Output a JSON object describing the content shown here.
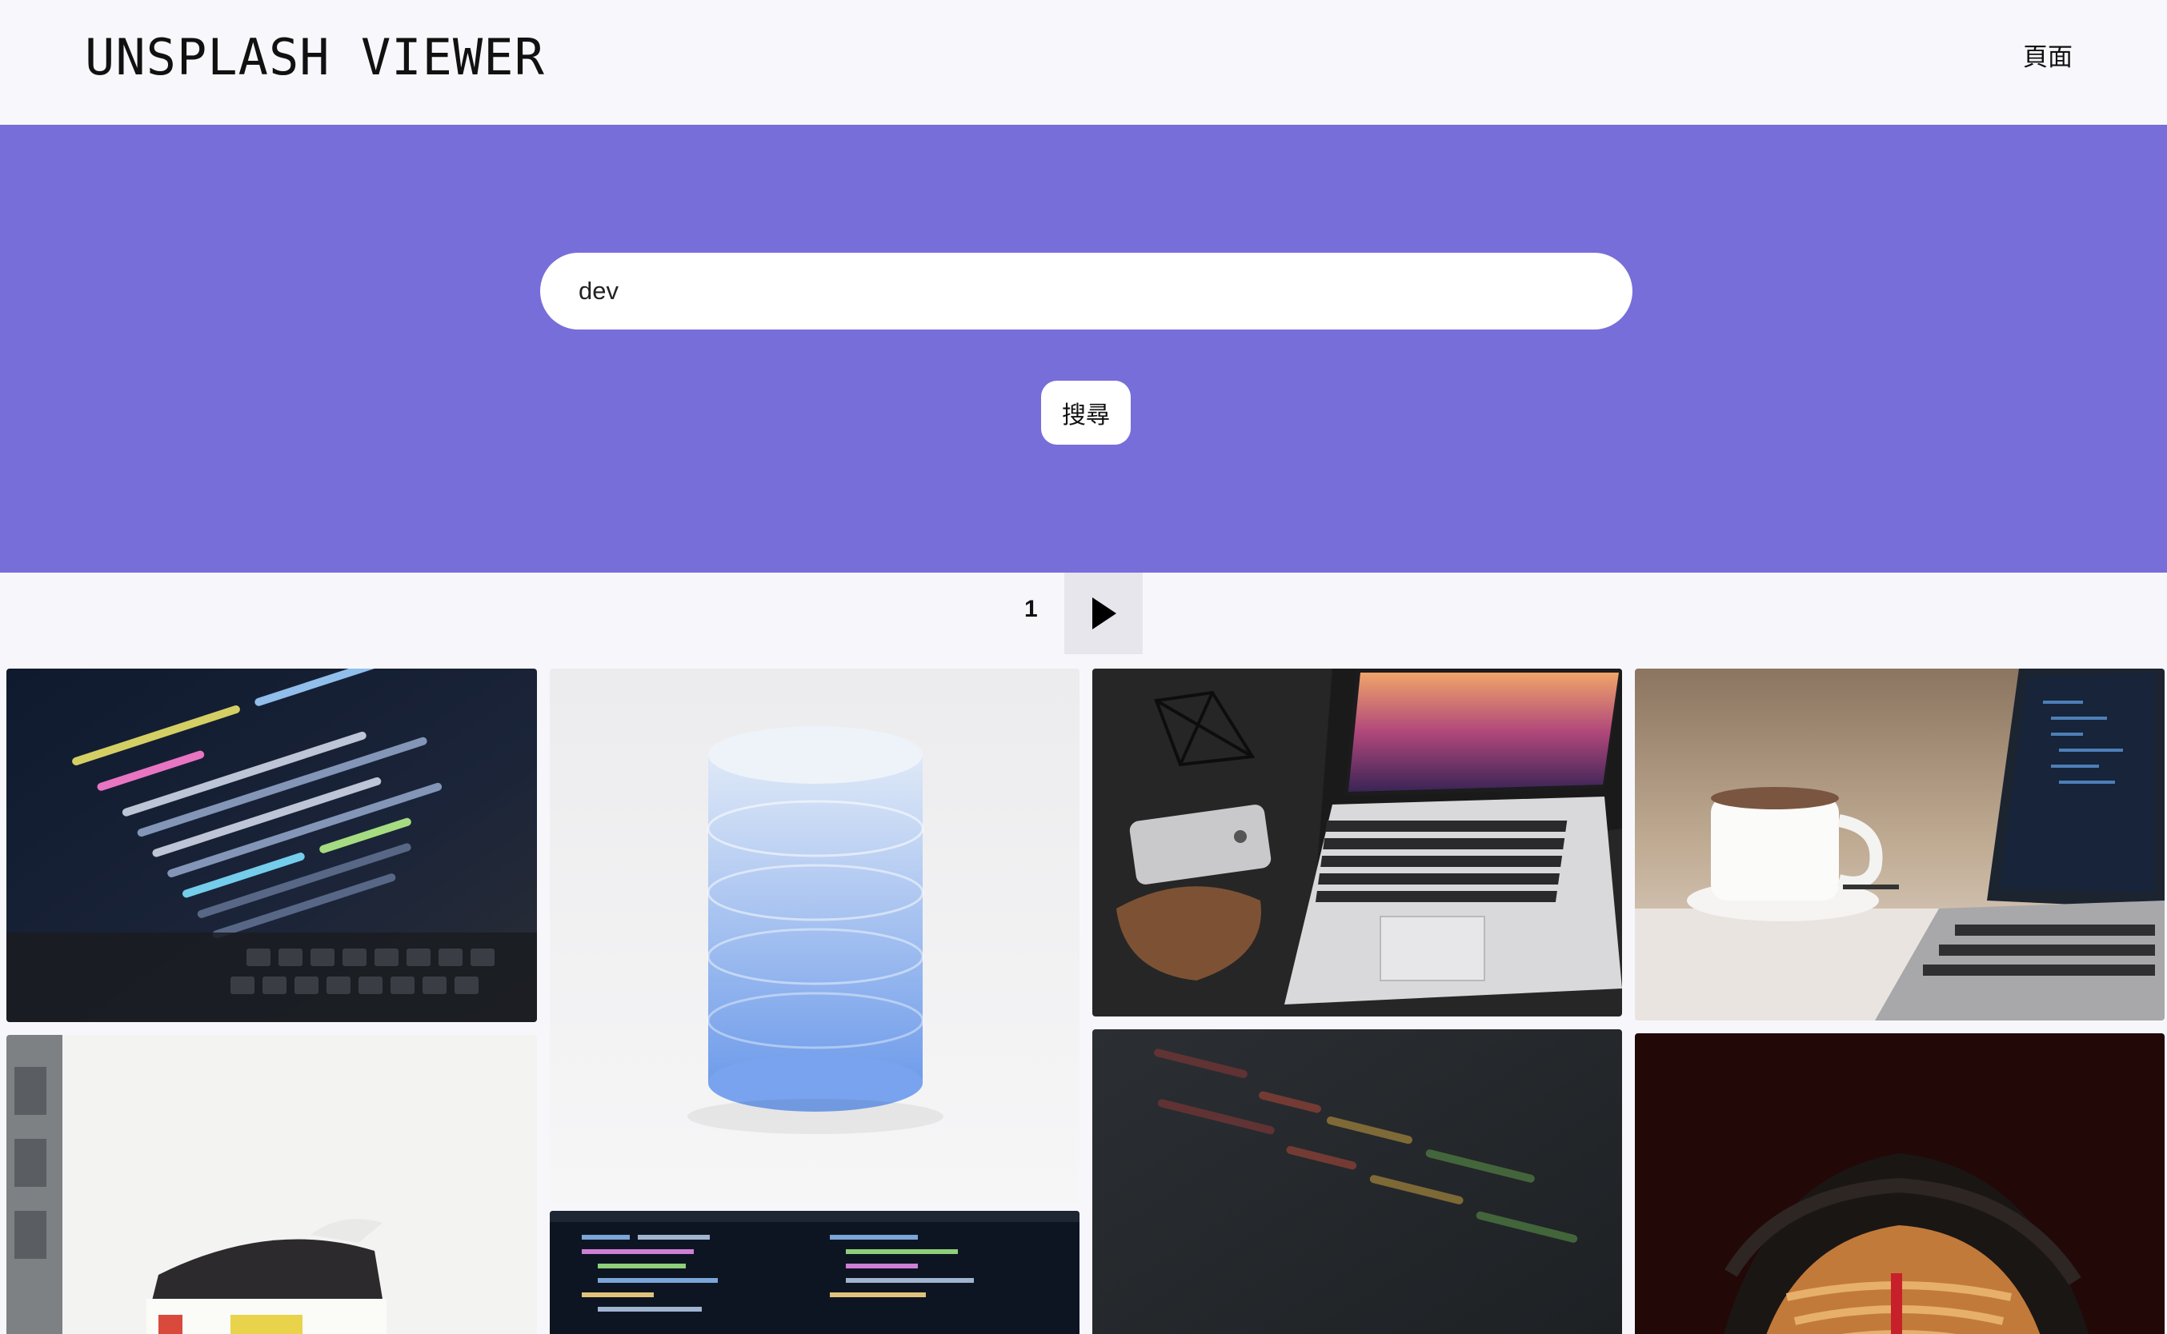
{
  "header": {
    "app_title": "UNSPLASH VIEWER",
    "nav_link": "頁面"
  },
  "search": {
    "query_value": "dev",
    "button_label": "搜尋"
  },
  "pagination": {
    "current_page": "1",
    "next_icon": "play-triangle-icon"
  },
  "colors": {
    "hero_background": "#776ed9",
    "page_background": "#f7f7fb",
    "next_button_background": "#e6e6ec"
  },
  "photos": [
    {
      "name": "photo-code-editor-laptop",
      "subject": "code on laptop screen"
    },
    {
      "name": "photo-database-cylinder",
      "subject": "blue stacked database cylinder"
    },
    {
      "name": "photo-laptop-phone-desk",
      "subject": "laptop, phone and sunglasses case on desk"
    },
    {
      "name": "photo-coffee-laptop",
      "subject": "coffee cup beside laptop"
    },
    {
      "name": "photo-street-building",
      "subject": "street scene with building"
    },
    {
      "name": "photo-code-dark-editor",
      "subject": "dark code editor"
    },
    {
      "name": "photo-blurred-code",
      "subject": "blurred code on screen"
    },
    {
      "name": "photo-portrait-face-paint",
      "subject": "portrait with face paint"
    }
  ]
}
